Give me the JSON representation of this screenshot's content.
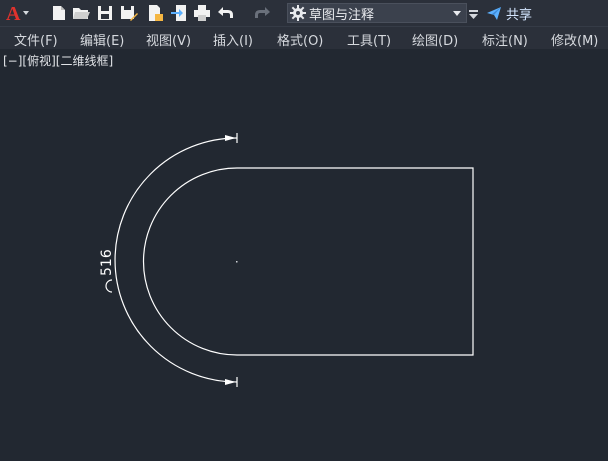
{
  "toolbar": {
    "icons": [
      "app-logo-icon",
      "new-file-icon",
      "open-folder-icon",
      "save-icon",
      "save-as-icon",
      "publish-icon",
      "import-icon",
      "print-icon",
      "undo-icon",
      "redo-icon"
    ],
    "workspace": "草图与注释",
    "share_label": "共享",
    "accent_color": "#5cb1ff",
    "logo_color": "#e0322d"
  },
  "menu": {
    "items": [
      "文件(F)",
      "编辑(E)",
      "视图(V)",
      "插入(I)",
      "格式(O)",
      "工具(T)",
      "绘图(D)",
      "标注(N)",
      "修改(M)"
    ]
  },
  "viewport": {
    "label": "[−][俯视][二维线框]",
    "background": "#222831"
  },
  "drawing": {
    "dimension_text": "516",
    "line_color": "#ffffff"
  }
}
